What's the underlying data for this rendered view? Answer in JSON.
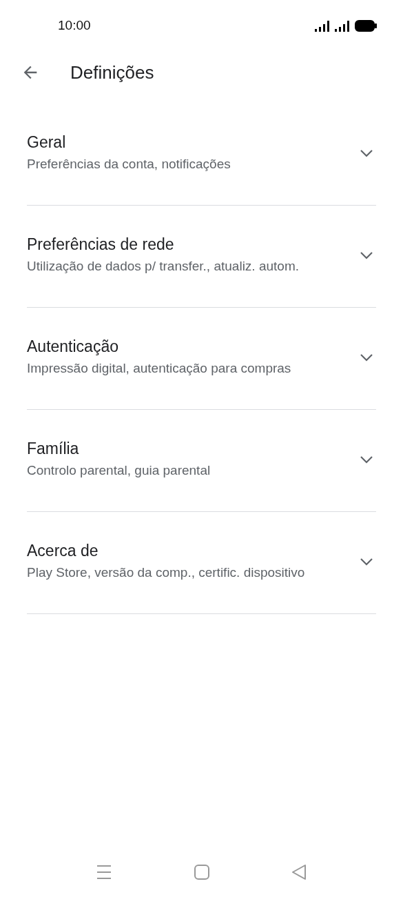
{
  "status_bar": {
    "time": "10:00"
  },
  "app_bar": {
    "title": "Definições"
  },
  "sections": [
    {
      "title": "Geral",
      "subtitle": "Preferências da conta, notificações",
      "expanded": false
    },
    {
      "title": "Preferências de rede",
      "subtitle": "Utilização de dados p/ transfer., atualiz. autom.",
      "expanded": false
    },
    {
      "title": "Autenticação",
      "subtitle": "Impressão digital, autenticação para compras",
      "expanded": false
    },
    {
      "title": "Família",
      "subtitle": "Controlo parental, guia parental",
      "expanded": false
    },
    {
      "title": "Acerca de",
      "subtitle": "Play Store, versão da comp., certific. dispositivo",
      "expanded": false
    }
  ]
}
